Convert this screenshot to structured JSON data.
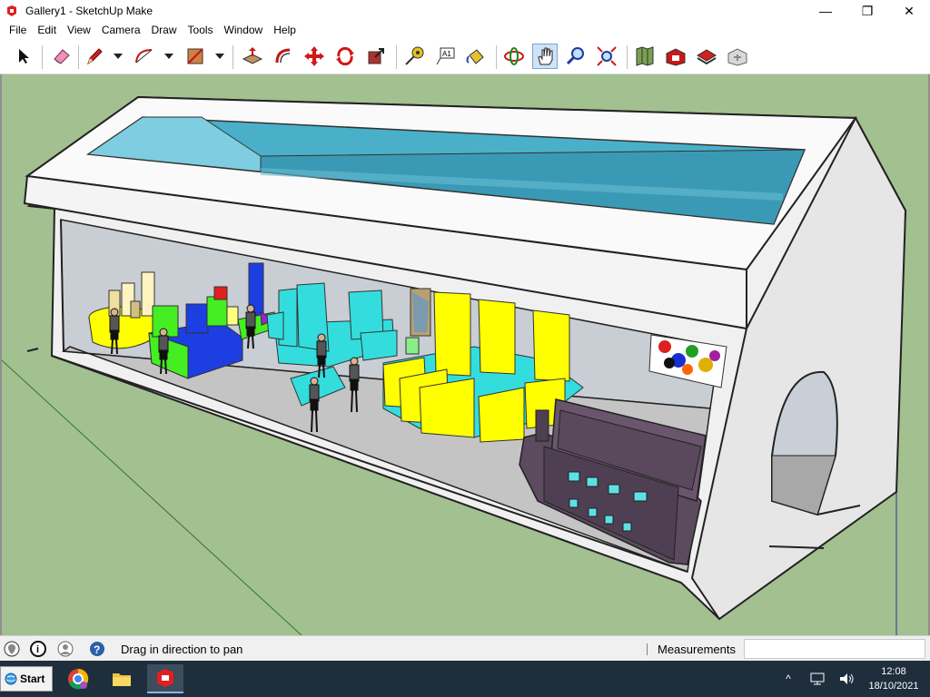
{
  "window": {
    "title": "Gallery1 - SketchUp Make",
    "minimize_glyph": "—",
    "maximize_glyph": "❐",
    "close_glyph": "✕"
  },
  "menu": [
    "File",
    "Edit",
    "View",
    "Camera",
    "Draw",
    "Tools",
    "Window",
    "Help"
  ],
  "toolbar": {
    "tools": [
      {
        "name": "select-tool",
        "icon": "arrow-cursor-icon"
      },
      {
        "name": "eraser-tool",
        "icon": "eraser-icon"
      },
      {
        "name": "line-tool",
        "icon": "pencil-icon"
      },
      {
        "name": "arc-tool",
        "icon": "arc-icon"
      },
      {
        "name": "rectangle-tool",
        "icon": "rectangle-icon"
      },
      {
        "name": "push-pull-tool",
        "icon": "push-pull-icon"
      },
      {
        "name": "offset-tool",
        "icon": "offset-icon"
      },
      {
        "name": "move-tool",
        "icon": "move-arrows-icon"
      },
      {
        "name": "rotate-tool",
        "icon": "rotate-icon"
      },
      {
        "name": "scale-tool",
        "icon": "scale-icon"
      },
      {
        "name": "tape-measure-tool",
        "icon": "tape-measure-icon"
      },
      {
        "name": "text-tool",
        "icon": "text-label-icon"
      },
      {
        "name": "paint-bucket-tool",
        "icon": "paint-bucket-icon"
      },
      {
        "name": "orbit-tool",
        "icon": "orbit-icon"
      },
      {
        "name": "pan-tool",
        "icon": "pan-hand-icon",
        "active": true
      },
      {
        "name": "zoom-tool",
        "icon": "magnifier-icon"
      },
      {
        "name": "zoom-extents-tool",
        "icon": "zoom-extents-icon"
      },
      {
        "name": "add-location-tool",
        "icon": "map-icon"
      },
      {
        "name": "3d-warehouse-tool",
        "icon": "warehouse-icon"
      },
      {
        "name": "share-model-tool",
        "icon": "share-model-icon"
      },
      {
        "name": "extension-warehouse-tool",
        "icon": "extension-icon"
      }
    ],
    "text_tool_glyph": "A1"
  },
  "status": {
    "hint": "Drag in direction to pan",
    "measurements_label": "Measurements",
    "measurements_value": "",
    "info_glyph": "i",
    "help_glyph": "?"
  },
  "taskbar": {
    "start_label": "Start",
    "time": "12:08",
    "date": "18/10/2021",
    "tray_chevron": "^"
  },
  "colors": {
    "ground": "#a3c090",
    "roof_glass": "#4ab0c9",
    "wall": "#f0f0f0",
    "floor": "#c4c4c4",
    "yellow_blocks": "#ffff00",
    "cyan_blocks": "#33dddd",
    "blue_blocks": "#1d3ee0",
    "purple_building": "#5c4a5e"
  }
}
